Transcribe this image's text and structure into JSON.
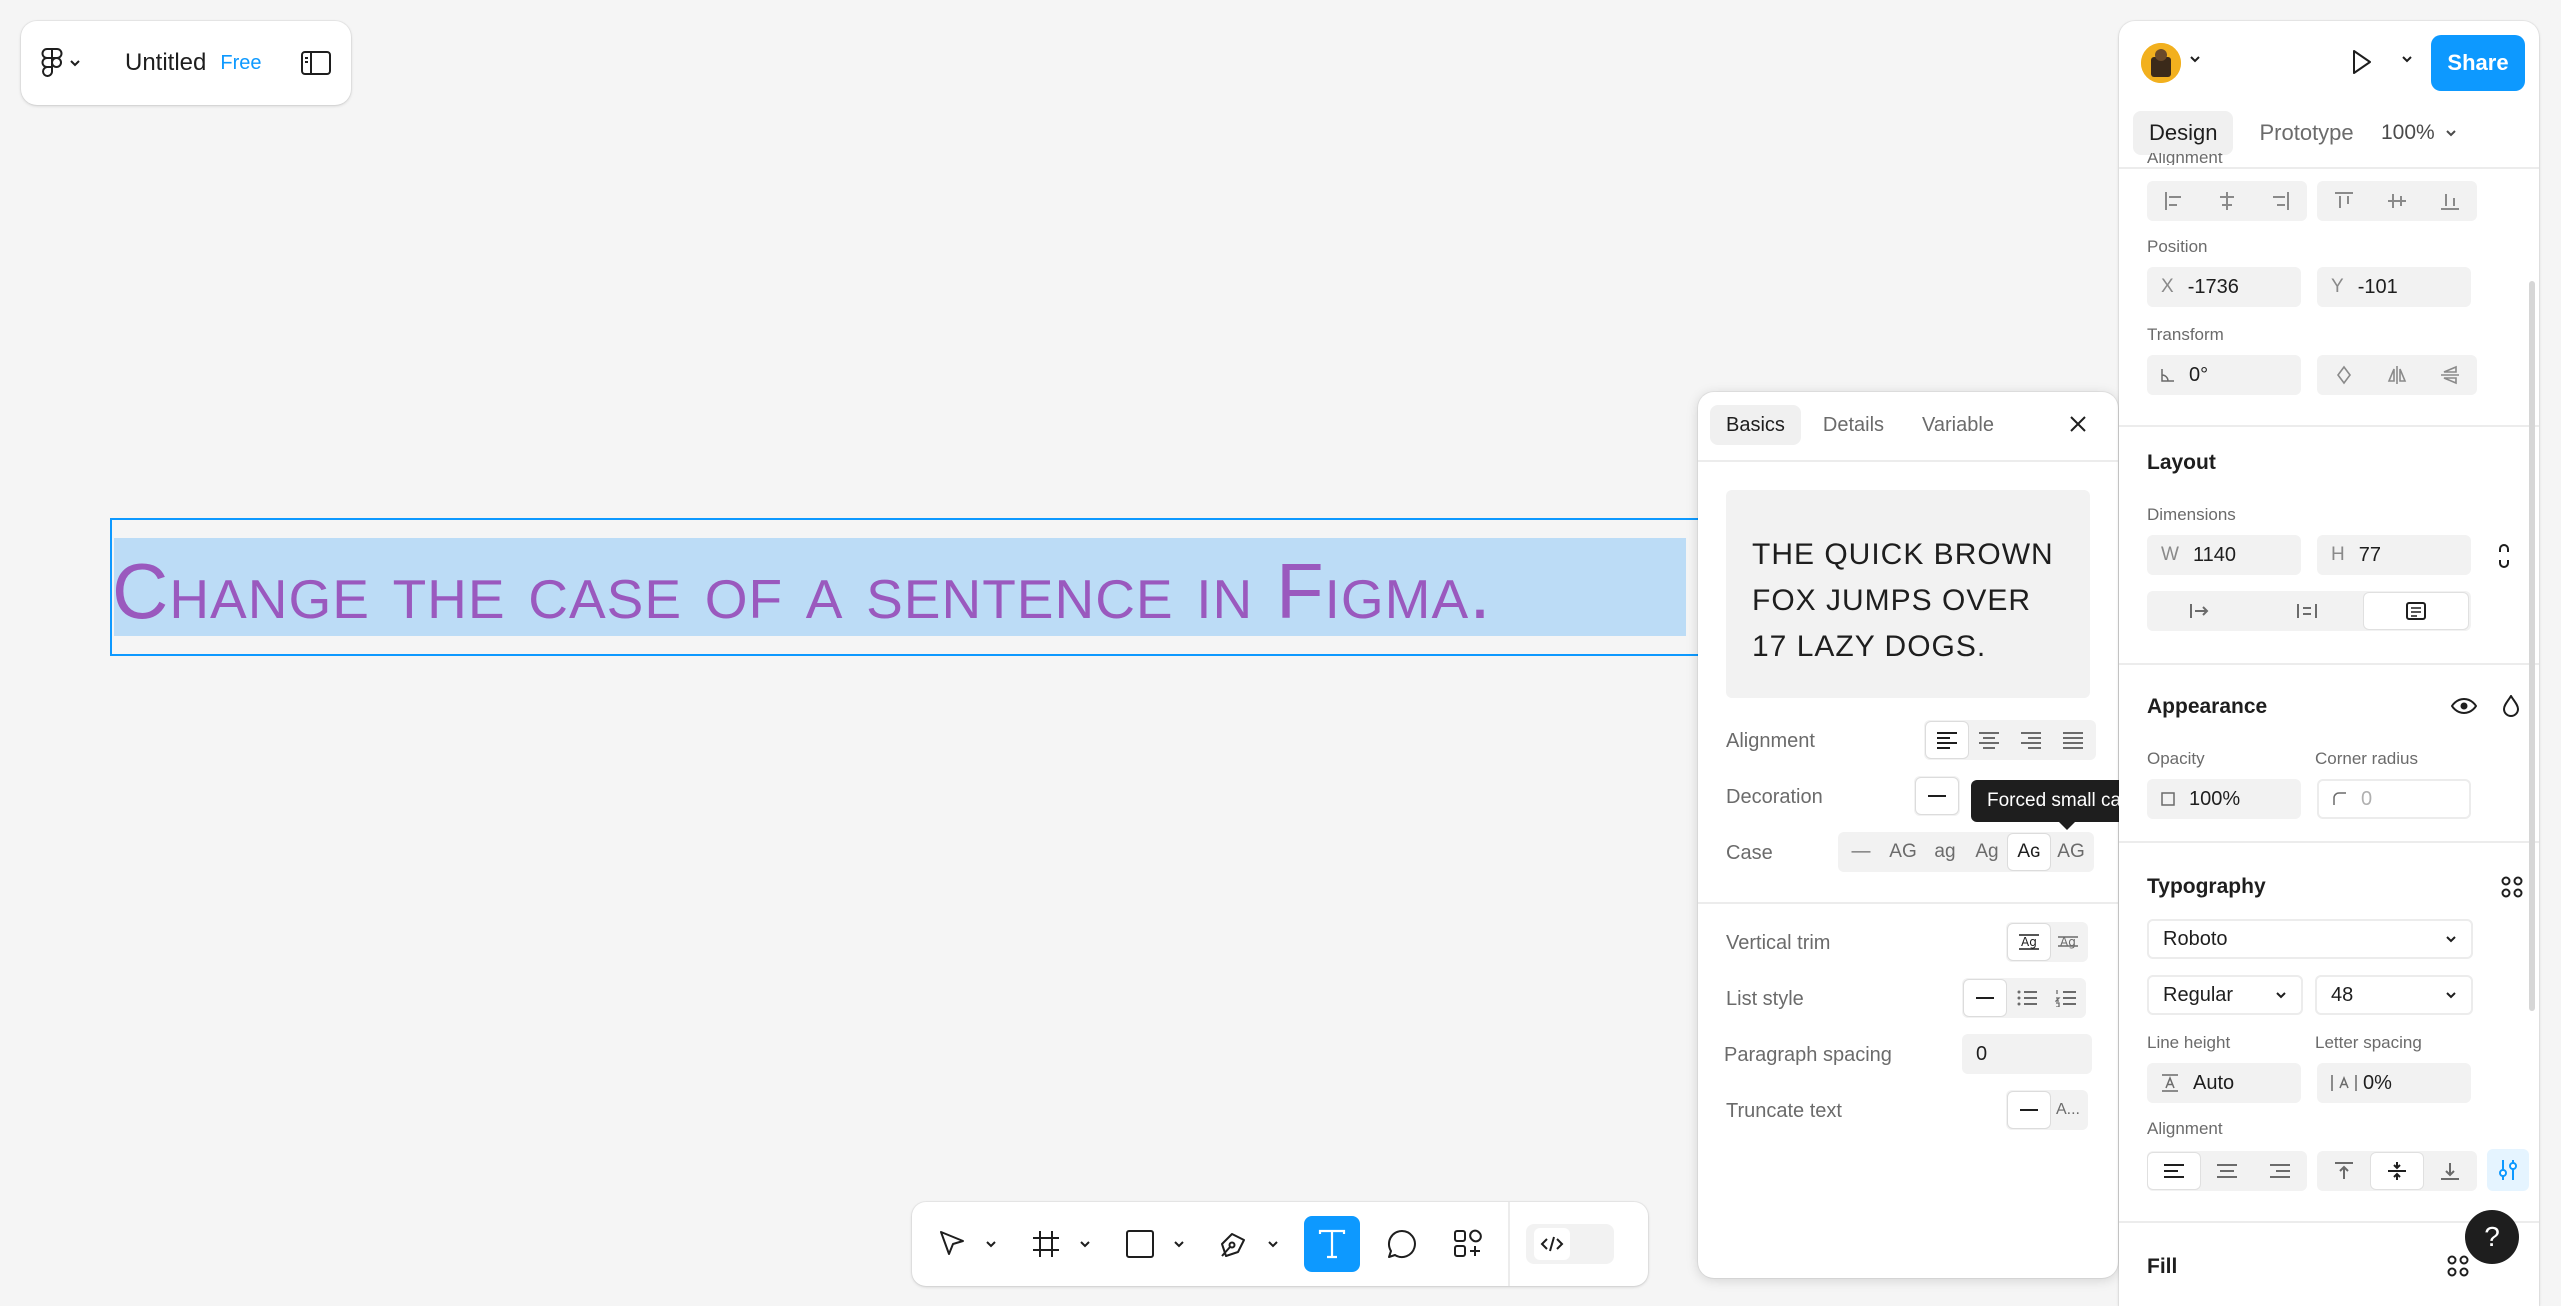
{
  "file": {
    "title": "Untitled",
    "plan": "Free"
  },
  "canvas": {
    "text": "Change the case of a sentence in Figma."
  },
  "right_panel": {
    "share_label": "Share",
    "tabs": [
      {
        "label": "Design"
      },
      {
        "label": "Prototype"
      }
    ],
    "zoom": "100%",
    "alignment_label": "Alignment",
    "position": {
      "label": "Position",
      "x_prefix": "X",
      "x": "-1736",
      "y_prefix": "Y",
      "y": "-101"
    },
    "transform": {
      "label": "Transform",
      "rotation": "0°"
    },
    "layout": {
      "title": "Layout",
      "dimensions_label": "Dimensions",
      "w_prefix": "W",
      "w": "1140",
      "h_prefix": "H",
      "h": "77"
    },
    "appearance": {
      "title": "Appearance",
      "opacity_label": "Opacity",
      "opacity": "100%",
      "radius_label": "Corner radius",
      "radius": "0"
    },
    "typography": {
      "title": "Typography",
      "font": "Roboto",
      "weight": "Regular",
      "size": "48",
      "line_height_label": "Line height",
      "line_height": "Auto",
      "letter_spacing_label": "Letter spacing",
      "letter_spacing": "0%",
      "alignment_label": "Alignment"
    },
    "fill": {
      "title": "Fill"
    }
  },
  "popup": {
    "tabs": [
      {
        "label": "Basics"
      },
      {
        "label": "Details"
      },
      {
        "label": "Variable"
      }
    ],
    "preview": "THE QUICK BROWN FOX JUMPS OVER 17 LAZY DOGS.",
    "alignment_label": "Alignment",
    "decoration_label": "Decoration",
    "case_label": "Case",
    "case_options": [
      "—",
      "AG",
      "ag",
      "Ag",
      "Aɢ",
      "AG"
    ],
    "vertical_trim_label": "Vertical trim",
    "list_style_label": "List style",
    "paragraph_spacing_label": "Paragraph spacing",
    "paragraph_spacing": "0",
    "truncate_label": "Truncate text",
    "truncate_option": "A...",
    "tooltip": "Forced small caps"
  },
  "help": "?",
  "colors": {
    "accent": "#0d99ff",
    "canvas_text": "#9a59be",
    "selection": "#bcdcf6"
  }
}
